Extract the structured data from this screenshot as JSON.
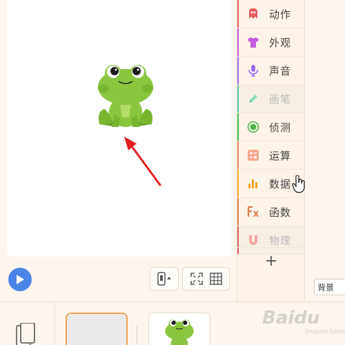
{
  "categories": [
    {
      "label": "动作",
      "icon": "motion-icon",
      "color": "#e95b5b",
      "disabled": false
    },
    {
      "label": "外观",
      "icon": "looks-shirt-icon",
      "color": "#c65be0",
      "disabled": false
    },
    {
      "label": "声音",
      "icon": "sound-mic-icon",
      "color": "#9b6cf0",
      "disabled": false
    },
    {
      "label": "画笔",
      "icon": "pen-icon",
      "color": "#5cc9a7",
      "disabled": true
    },
    {
      "label": "侦测",
      "icon": "sensing-icon",
      "color": "#4cbb4c",
      "disabled": false
    },
    {
      "label": "运算",
      "icon": "operators-icon",
      "color": "#f08a6a",
      "disabled": false
    },
    {
      "label": "数据",
      "icon": "data-chart-icon",
      "color": "#f5a623",
      "disabled": false
    },
    {
      "label": "函数",
      "icon": "functions-icon",
      "color": "#e07a4a",
      "disabled": false
    },
    {
      "label": "物理",
      "icon": "physics-magnet-icon",
      "color": "#e05a5a",
      "disabled": true
    }
  ],
  "add_label": "+",
  "background_select": "背景",
  "watermark": {
    "main": "Baidu",
    "sub": "jingyan.baidu.com"
  }
}
